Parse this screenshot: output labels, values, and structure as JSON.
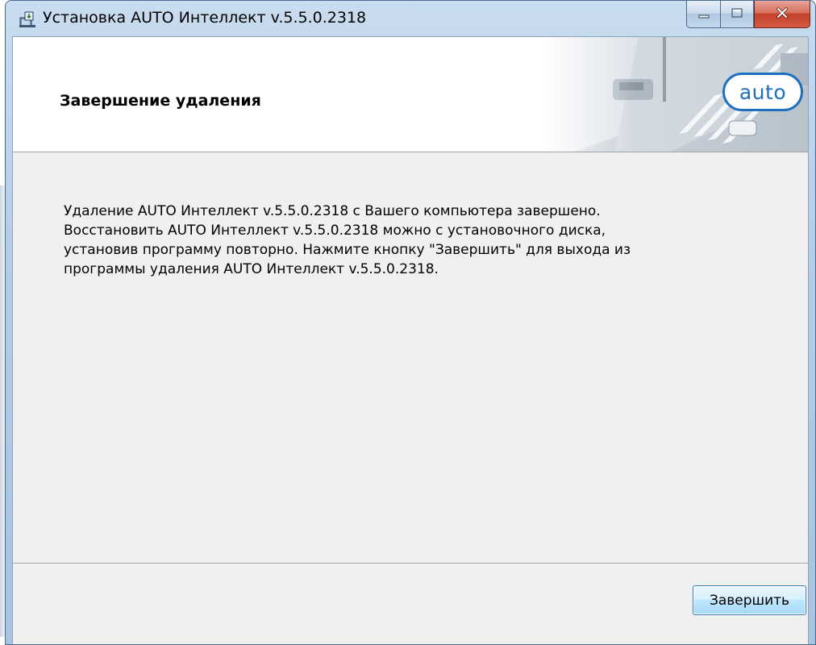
{
  "window": {
    "title": "Установка AUTO Интеллект v.5.5.0.2318"
  },
  "banner": {
    "title": "Завершение удаления",
    "logo_text": "auto"
  },
  "message": {
    "lines": [
      "Удаление AUTO Интеллект v.5.5.0.2318 с Вашего компьютера завершено.",
      "Восстановить AUTO Интеллект v.5.5.0.2318 можно с установочного диска,",
      "установив программу повторно. Нажмите кнопку \"Завершить\" для выхода из",
      "программы удаления AUTO Интеллект v.5.5.0.2318."
    ]
  },
  "buttons": {
    "finish": "Завершить"
  },
  "icons": {
    "app": "installer-icon",
    "minimize": "minimize-icon",
    "maximize": "maximize-icon",
    "close": "close-icon"
  },
  "colors": {
    "close_button": "#c2402a",
    "logo_blue": "#1f6fc0",
    "title_frame": "#b4cde6"
  }
}
